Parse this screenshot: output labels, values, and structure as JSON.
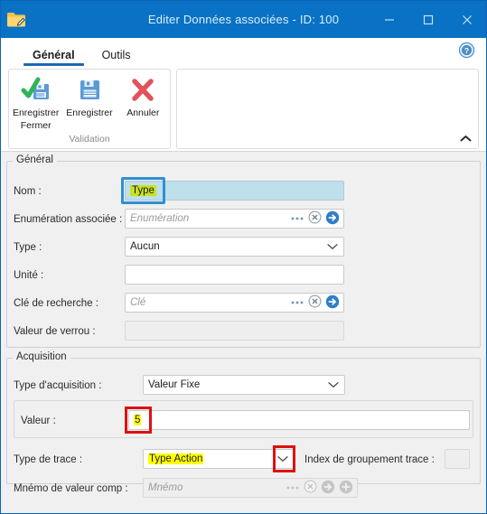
{
  "window": {
    "title": "Editer Données associées - ID: 100",
    "app_icon": "folder-edit-icon",
    "minimize_label": "—",
    "maximize_label": "□",
    "close_label": "✕"
  },
  "tabs": [
    {
      "label": "Général",
      "active": true
    },
    {
      "label": "Outils",
      "active": false
    }
  ],
  "help": {
    "label": "?",
    "icon": "help-icon"
  },
  "ribbon": {
    "group_title": "Validation",
    "collapse_icon": "chevron-up-icon",
    "buttons": [
      {
        "label_line1": "Enregistrer",
        "label_line2": "Fermer",
        "icon": "save-and-close-icon"
      },
      {
        "label_line1": "Enregistrer",
        "label_line2": "",
        "icon": "save-icon"
      },
      {
        "label_line1": "Annuler",
        "label_line2": "",
        "icon": "cancel-icon"
      }
    ]
  },
  "general": {
    "legend": "Général",
    "nom": {
      "label": "Nom :",
      "value": "Type"
    },
    "enumeration": {
      "label": "Enumération associée :",
      "placeholder": "Enumération"
    },
    "type": {
      "label": "Type :",
      "value": "Aucun"
    },
    "unite": {
      "label": "Unité :",
      "value": ""
    },
    "cle": {
      "label": "Clé de recherche :",
      "placeholder": "Clé"
    },
    "verrou": {
      "label": "Valeur de verrou :",
      "value": ""
    }
  },
  "acquisition": {
    "legend": "Acquisition",
    "type_acquisition": {
      "label": "Type d'acquisition :",
      "value": "Valeur Fixe"
    },
    "valeur": {
      "label": "Valeur :",
      "value": "5"
    },
    "type_trace": {
      "label": "Type de trace :",
      "value": "Type Action"
    },
    "index_groupement": {
      "label": "Index de groupement trace :",
      "value": ""
    },
    "mnemo": {
      "label": "Mnémo de valeur comp :",
      "placeholder": "Mnémo"
    }
  },
  "icons": {
    "ellipsis": "ellipsis-icon",
    "clear": "clear-circle-icon",
    "goto": "goto-circle-arrow-icon",
    "add": "add-circle-icon",
    "dropdown": "chevron-down-icon"
  },
  "colors": {
    "titlebar": "#0a72c4",
    "tab_underline": "#1c69b4",
    "highlight_yellow": "#ffff00",
    "highlight_green": "#c9e222",
    "annotation_blue": "#2f8fd4",
    "annotation_red": "#dd1111",
    "field_blue": "#bfdfeb"
  }
}
